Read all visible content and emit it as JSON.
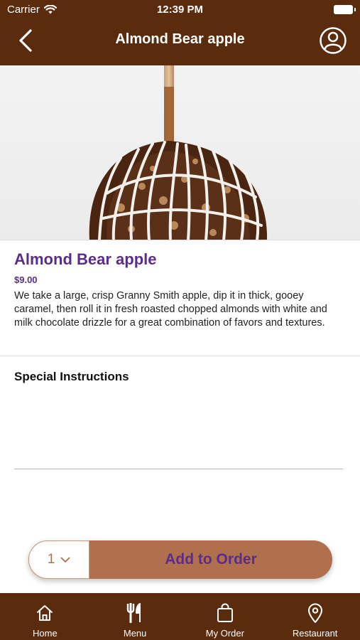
{
  "status_bar": {
    "carrier": "Carrier",
    "time": "12:39 PM"
  },
  "nav": {
    "title": "Almond Bear apple"
  },
  "product": {
    "name": "Almond Bear apple",
    "price": "$9.00",
    "description": "We take a large, crisp Granny Smith apple, dip it in thick, gooey caramel, then roll it in fresh roasted chopped almonds with white and milk chocolate drizzle for a great combination of favors and textures."
  },
  "instructions": {
    "label": "Special Instructions",
    "placeholder": ""
  },
  "order": {
    "quantity": "1",
    "add_label": "Add to Order"
  },
  "tabs": [
    {
      "label": "Home",
      "icon": "home-icon"
    },
    {
      "label": "Menu",
      "icon": "fork-knife-icon"
    },
    {
      "label": "My Order",
      "icon": "shopping-bag-icon"
    },
    {
      "label": "Restaurant",
      "icon": "location-pin-icon"
    }
  ],
  "colors": {
    "header": "#5a2b0d",
    "accent": "#5b2d8a",
    "button": "#b07050"
  }
}
